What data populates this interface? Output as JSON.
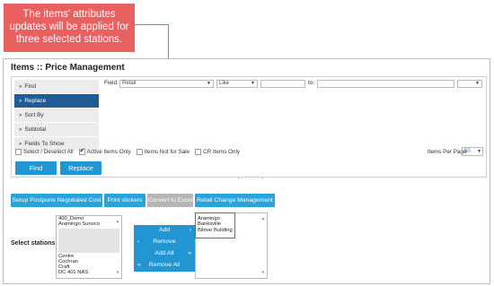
{
  "callout": {
    "text": "The items' attributes updates will be applied for three selected stations."
  },
  "window": {
    "title": "Items :: Price Management"
  },
  "menu": {
    "items": [
      {
        "label": "Find"
      },
      {
        "label": "Replace"
      },
      {
        "label": "Sort By"
      },
      {
        "label": "Subtotal"
      },
      {
        "label": "Fields To Show"
      }
    ],
    "active_index": 1,
    "arrow_glyph": "»"
  },
  "replace_form": {
    "field_label": "Field:",
    "field_value": "Retail",
    "operator_value": "Like",
    "value_input": "",
    "to_label": "to:",
    "to_input": "",
    "extra_select_value": ""
  },
  "options": {
    "select_all": {
      "label": "Select / Deselect All",
      "checked": false
    },
    "active_only": {
      "label": "Active Items Only",
      "checked": true
    },
    "not_for_sale": {
      "label": "Items Not for Sale",
      "checked": false
    },
    "cr_only": {
      "label": "CR Items Only",
      "checked": false
    },
    "items_per_page_label": "Items Per Page",
    "items_per_page_value": "50"
  },
  "actions": {
    "find": "Find",
    "replace": "Replace"
  },
  "toolbar": {
    "setup_postpone": "Setup Postpone Negotiated Cost",
    "print_stickers": "Print stickers",
    "convert_excel": "Convert to Excel",
    "retail_change": "Retail Change Management"
  },
  "stations": {
    "label": "Select stations:",
    "available": [
      "400_Demo",
      "Aramingo Sunoco",
      "Centre",
      "Cochran",
      "Craft",
      "DC 401 NAS"
    ],
    "selected": [
      "Aramingo",
      "Banksville",
      "Bilmar Building"
    ]
  },
  "transfer": {
    "add": "Add",
    "remove": "Remove",
    "add_all": "Add All",
    "remove_all": "Remove All"
  },
  "colors": {
    "callout": "#e96060",
    "primary_blue": "#2196d3",
    "menu_active": "#1f5c96",
    "disabled": "#b5b5b5",
    "highlight": "#e23b3b"
  }
}
